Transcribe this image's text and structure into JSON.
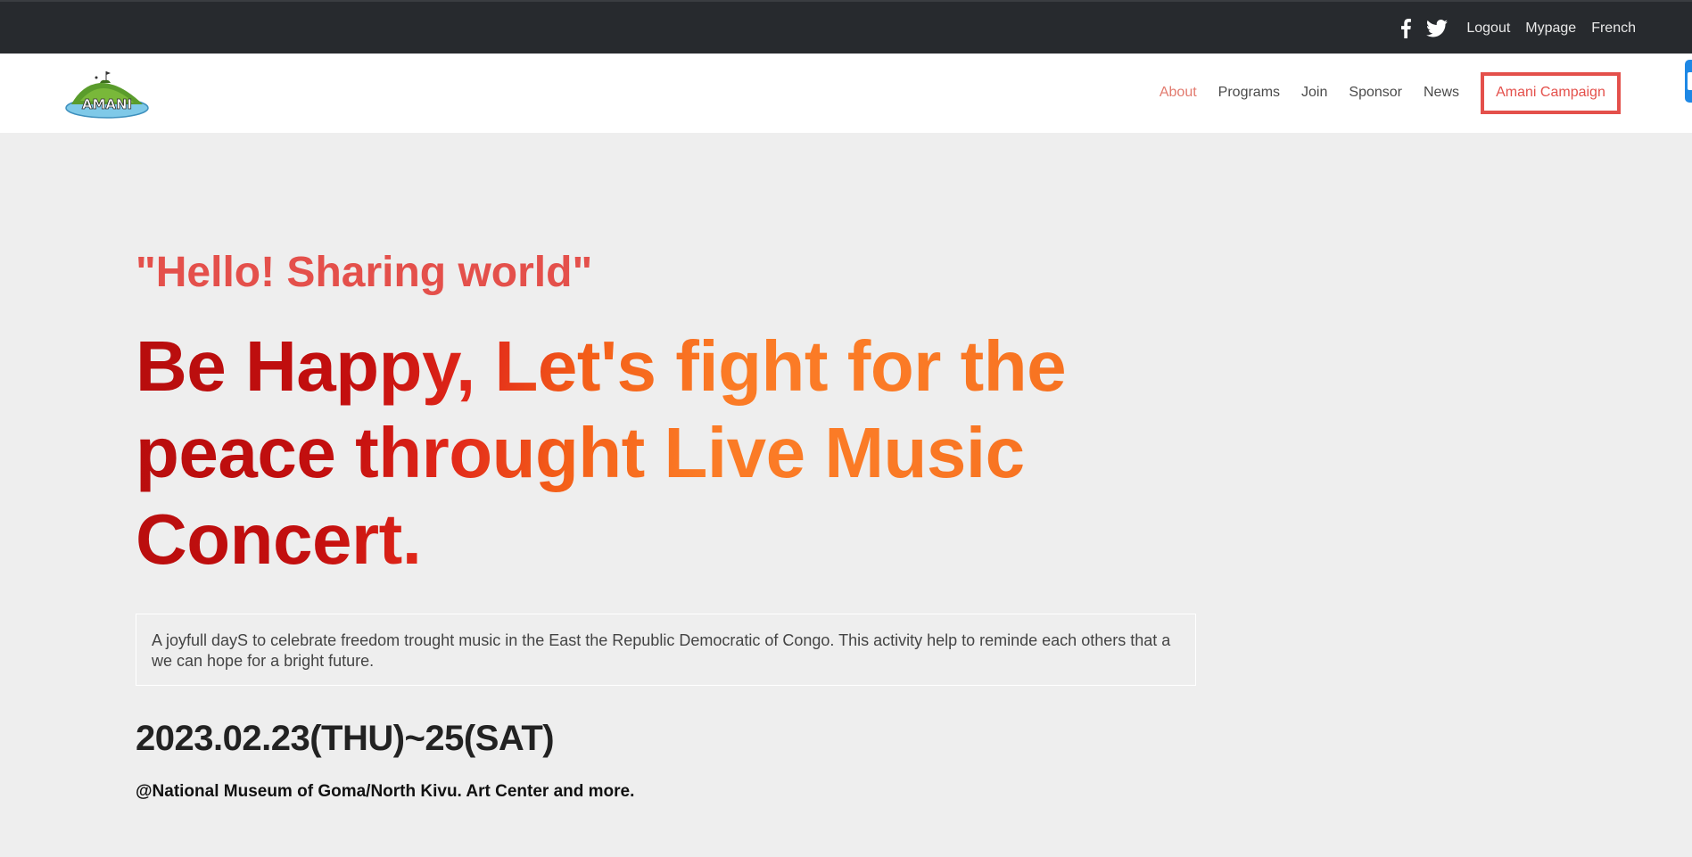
{
  "topbar": {
    "icons": [
      "facebook-icon",
      "twitter-icon"
    ],
    "links": [
      "Logout",
      "Mypage",
      "French"
    ]
  },
  "header": {
    "logo_text": "AMANI",
    "nav": [
      "About",
      "Programs",
      "Join",
      "Sponsor",
      "News"
    ],
    "active_nav": "About",
    "campaign_button": "Amani Campaign"
  },
  "hero": {
    "tagline": "\"Hello! Sharing world\"",
    "headline": "Be Happy, Let's fight for the peace throught Live Music Concert.",
    "description": "A joyfull dayS to celebrate freedom trought music in the East the Republic Democratic of Congo. This activity help to reminde each others that a we can hope for a bright future.",
    "date": "2023.02.23(THU)~25(SAT)",
    "venue": "@National Museum of Goma/North Kivu. Art Center and more."
  },
  "colors": {
    "topbar_bg": "#272a2e",
    "accent": "#e4504b",
    "headline_dark": "#b70d0d",
    "headline_orange": "#fb7b26",
    "page_bg": "#eeeeee"
  }
}
